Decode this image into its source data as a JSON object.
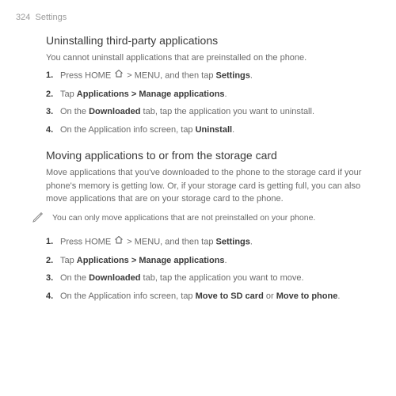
{
  "page": {
    "number": "324",
    "breadcrumb": "Settings"
  },
  "section1": {
    "title": "Uninstalling third-party applications",
    "intro": "You cannot uninstall applications that are preinstalled on the phone.",
    "steps": {
      "s1_a": "Press HOME ",
      "s1_b": " > MENU, and then tap ",
      "s1_c": "Settings",
      "s1_d": ".",
      "s2_a": "Tap ",
      "s2_b": "Applications > Manage applications",
      "s2_c": ".",
      "s3_a": "On the ",
      "s3_b": "Downloaded",
      "s3_c": " tab, tap the application you want to uninstall.",
      "s4_a": "On the Application info screen, tap ",
      "s4_b": "Uninstall",
      "s4_c": "."
    }
  },
  "section2": {
    "title": "Moving applications to or from the storage card",
    "intro": "Move applications that you've downloaded to the phone to the storage card if your phone's memory is getting low. Or, if your storage card is getting full, you can also move applications that are on your storage card to the phone.",
    "note": "You can only move applications that are not preinstalled on your phone.",
    "steps": {
      "s1_a": "Press HOME ",
      "s1_b": " > MENU, and then tap ",
      "s1_c": "Settings",
      "s1_d": ".",
      "s2_a": "Tap ",
      "s2_b": "Applications > Manage applications",
      "s2_c": ".",
      "s3_a": "On the ",
      "s3_b": "Downloaded",
      "s3_c": " tab, tap the application you want to move.",
      "s4_a": "On the Application info screen, tap ",
      "s4_b": "Move to SD card",
      "s4_c": " or ",
      "s4_d": "Move to phone",
      "s4_e": "."
    }
  }
}
